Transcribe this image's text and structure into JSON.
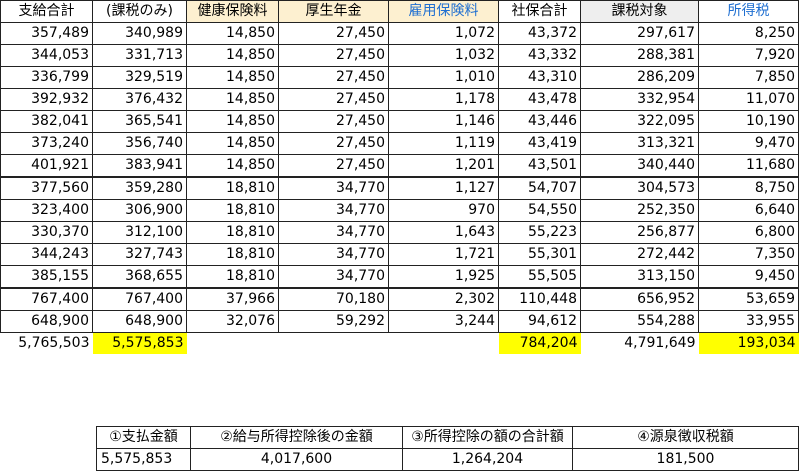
{
  "headers": [
    {
      "label": "支給合計",
      "style": "h-plain"
    },
    {
      "label": "(課税のみ)",
      "style": "h-plain"
    },
    {
      "label": "健康保険料",
      "style": "h-cream"
    },
    {
      "label": "厚生年金",
      "style": "h-cream"
    },
    {
      "label": "雇用保険料",
      "style": "h-cream-blue"
    },
    {
      "label": "社保合計",
      "style": "h-plain"
    },
    {
      "label": "課税対象",
      "style": "h-grey"
    },
    {
      "label": "所得税",
      "style": "h-blue"
    }
  ],
  "rows": [
    [
      "357,489",
      "340,989",
      "14,850",
      "27,450",
      "1,072",
      "43,372",
      "297,617",
      "8,250"
    ],
    [
      "344,053",
      "331,713",
      "14,850",
      "27,450",
      "1,032",
      "43,332",
      "288,381",
      "7,920"
    ],
    [
      "336,799",
      "329,519",
      "14,850",
      "27,450",
      "1,010",
      "43,310",
      "286,209",
      "7,850"
    ],
    [
      "392,932",
      "376,432",
      "14,850",
      "27,450",
      "1,178",
      "43,478",
      "332,954",
      "11,070"
    ],
    [
      "382,041",
      "365,541",
      "14,850",
      "27,450",
      "1,146",
      "43,446",
      "322,095",
      "10,190"
    ],
    [
      "373,240",
      "356,740",
      "14,850",
      "27,450",
      "1,119",
      "43,419",
      "313,321",
      "9,470"
    ],
    [
      "401,921",
      "383,941",
      "14,850",
      "27,450",
      "1,201",
      "43,501",
      "340,440",
      "11,680"
    ],
    [
      "377,560",
      "359,280",
      "18,810",
      "34,770",
      "1,127",
      "54,707",
      "304,573",
      "8,750"
    ],
    [
      "323,400",
      "306,900",
      "18,810",
      "34,770",
      "970",
      "54,550",
      "252,350",
      "6,640"
    ],
    [
      "330,370",
      "312,100",
      "18,810",
      "34,770",
      "1,643",
      "55,223",
      "256,877",
      "6,800"
    ],
    [
      "344,243",
      "327,743",
      "18,810",
      "34,770",
      "1,721",
      "55,301",
      "272,442",
      "7,350"
    ],
    [
      "385,155",
      "368,655",
      "18,810",
      "34,770",
      "1,925",
      "55,505",
      "313,150",
      "9,450"
    ],
    [
      "767,400",
      "767,400",
      "37,966",
      "70,180",
      "2,302",
      "110,448",
      "656,952",
      "53,659"
    ],
    [
      "648,900",
      "648,900",
      "32,076",
      "59,292",
      "3,244",
      "94,612",
      "554,288",
      "33,955"
    ]
  ],
  "totals": [
    "5,765,503",
    "5,575,853",
    "",
    "",
    "",
    "784,204",
    "4,791,649",
    "193,034"
  ],
  "highlight_color": "#ffff00",
  "header_blue": "#1f6fd1",
  "header_cream": "#fdf0d0",
  "summary": {
    "headers": [
      "①支払金額",
      "②給与所得控除後の金額",
      "③所得控除の額の合計額",
      "④源泉徴収税額"
    ],
    "values": [
      "5,575,853",
      "4,017,600",
      "1,264,204",
      "181,500"
    ]
  }
}
